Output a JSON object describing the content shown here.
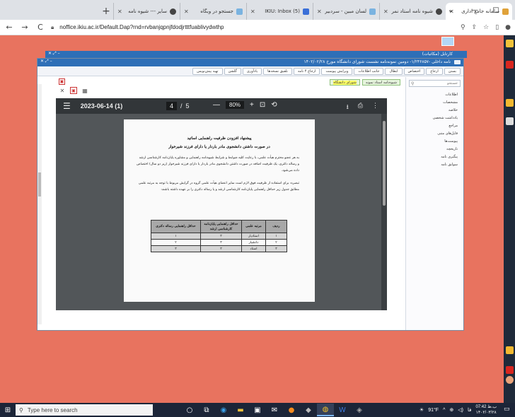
{
  "browser": {
    "tabs": [
      {
        "label": "سامانه جامع اداری",
        "active": true,
        "color": "#e0a23a"
      },
      {
        "label": "شیوه نامه استاد نمر",
        "color": "#444"
      },
      {
        "label": "لسان مبین - سردبیر",
        "color": "#7ab3e0"
      },
      {
        "label": "IKIU: Inbox (5)",
        "color": "#3a6fd8"
      },
      {
        "label": "جستجو در وبگاه",
        "color": "#7ab3e0"
      },
      {
        "label": "سایر --- شیوه نامه",
        "color": "#444"
      }
    ],
    "new_tab": "+",
    "chevron": "⌄",
    "minimize": "—",
    "maximize": "□",
    "close": "✕",
    "back": "←",
    "forward": "→",
    "reload": "C",
    "url": "noffice.ikiu.ac.ir/Default.Dap?rnd=rvbanjqpnjfdodjrtttfuablivydwthp"
  },
  "app": {
    "back_window_title": "کارتابل (مکاتبات)",
    "window_title": "نامه داخلی -۱/۲۳۶۸۵۷- دومین نمونه‌نامه نشست شورای دانشگاه مورخ ۱۴۰۲/۰۲/۲۸",
    "toolbar_buttons": [
      "بستن",
      "ارجاع",
      "اختصاص",
      "ابطال",
      "جانب اطلاعات",
      "ویرایش پیوست",
      "ارجاع ۴ نامه",
      "تلفیق نسخه‌ها",
      "یادآوری",
      "گلشن",
      "تهیه پیش‌نویس"
    ],
    "sidebar_search_placeholder": "جستجو",
    "sidebar_items": [
      "اطلاعات",
      "مشخصات",
      "خلاصه",
      "یادداشت شخصی",
      "مراجع",
      "فایل‌های متنی",
      "پیوست‌ها",
      "تاریخچه",
      "پیگیری نامه",
      "سوابق نامه"
    ],
    "crumbs": [
      "شیوه‌نامه استاد نمونه",
      "شورای دانشگاه"
    ],
    "pdf_title": "2023-06-14 (1)",
    "page_current": "4",
    "page_sep": "/",
    "page_total": "5",
    "zoom": "80%",
    "doc_heading1": "پیشنهاد افزودن ظرفیت راهنمایی اساتید",
    "doc_heading2": "در صورت داشتن دانشجوی مادر باردار یا دارای فرزند شیرخوار",
    "doc_para1": "به هر عضو محترم هیأت علمی، با رعایت کلیه ضوابط و شرایط شیوه‌نامه راهنمایی و مشاوره پایان‌نامه کارشناسی ارشد و رساله دکتری، یک ظرفیت اضافه در صورت داشتن دانشجوی مادر باردار یا دارای فرزند شیرخوار (زیر دو سال) اختصاص داده می‌شود.",
    "doc_para2": "تبصره: برای استفاده از ظرفیت فوق لازم است سایر اعضای هیأت علمی گروه در گرایش مربوط با توجه به مرتبه علمی مطابق جدول زیر حداقل راهنمایی پایان‌نامه کارشناسی ارشد و یا رساله دکتری را بر عهده داشته باشند:",
    "table": {
      "headers": [
        "ردیف",
        "مرتبه علمی",
        "حداقل راهنمایی پایان‌نامه کارشناسی ارشد",
        "حداقل راهنمایی رساله دکتری"
      ],
      "rows": [
        [
          "۱",
          "استادیار",
          "۳",
          "۱"
        ],
        [
          "۲",
          "دانشیار",
          "۳",
          "۲"
        ],
        [
          "۳",
          "استاد",
          "۳",
          "۳"
        ]
      ]
    }
  },
  "taskbar": {
    "search_placeholder": "Type here to search",
    "weather": "91°F",
    "time": "07:42 ب.ظ",
    "date": "۱۴۰۲/۰۳/۲۸",
    "lang": "فا"
  }
}
